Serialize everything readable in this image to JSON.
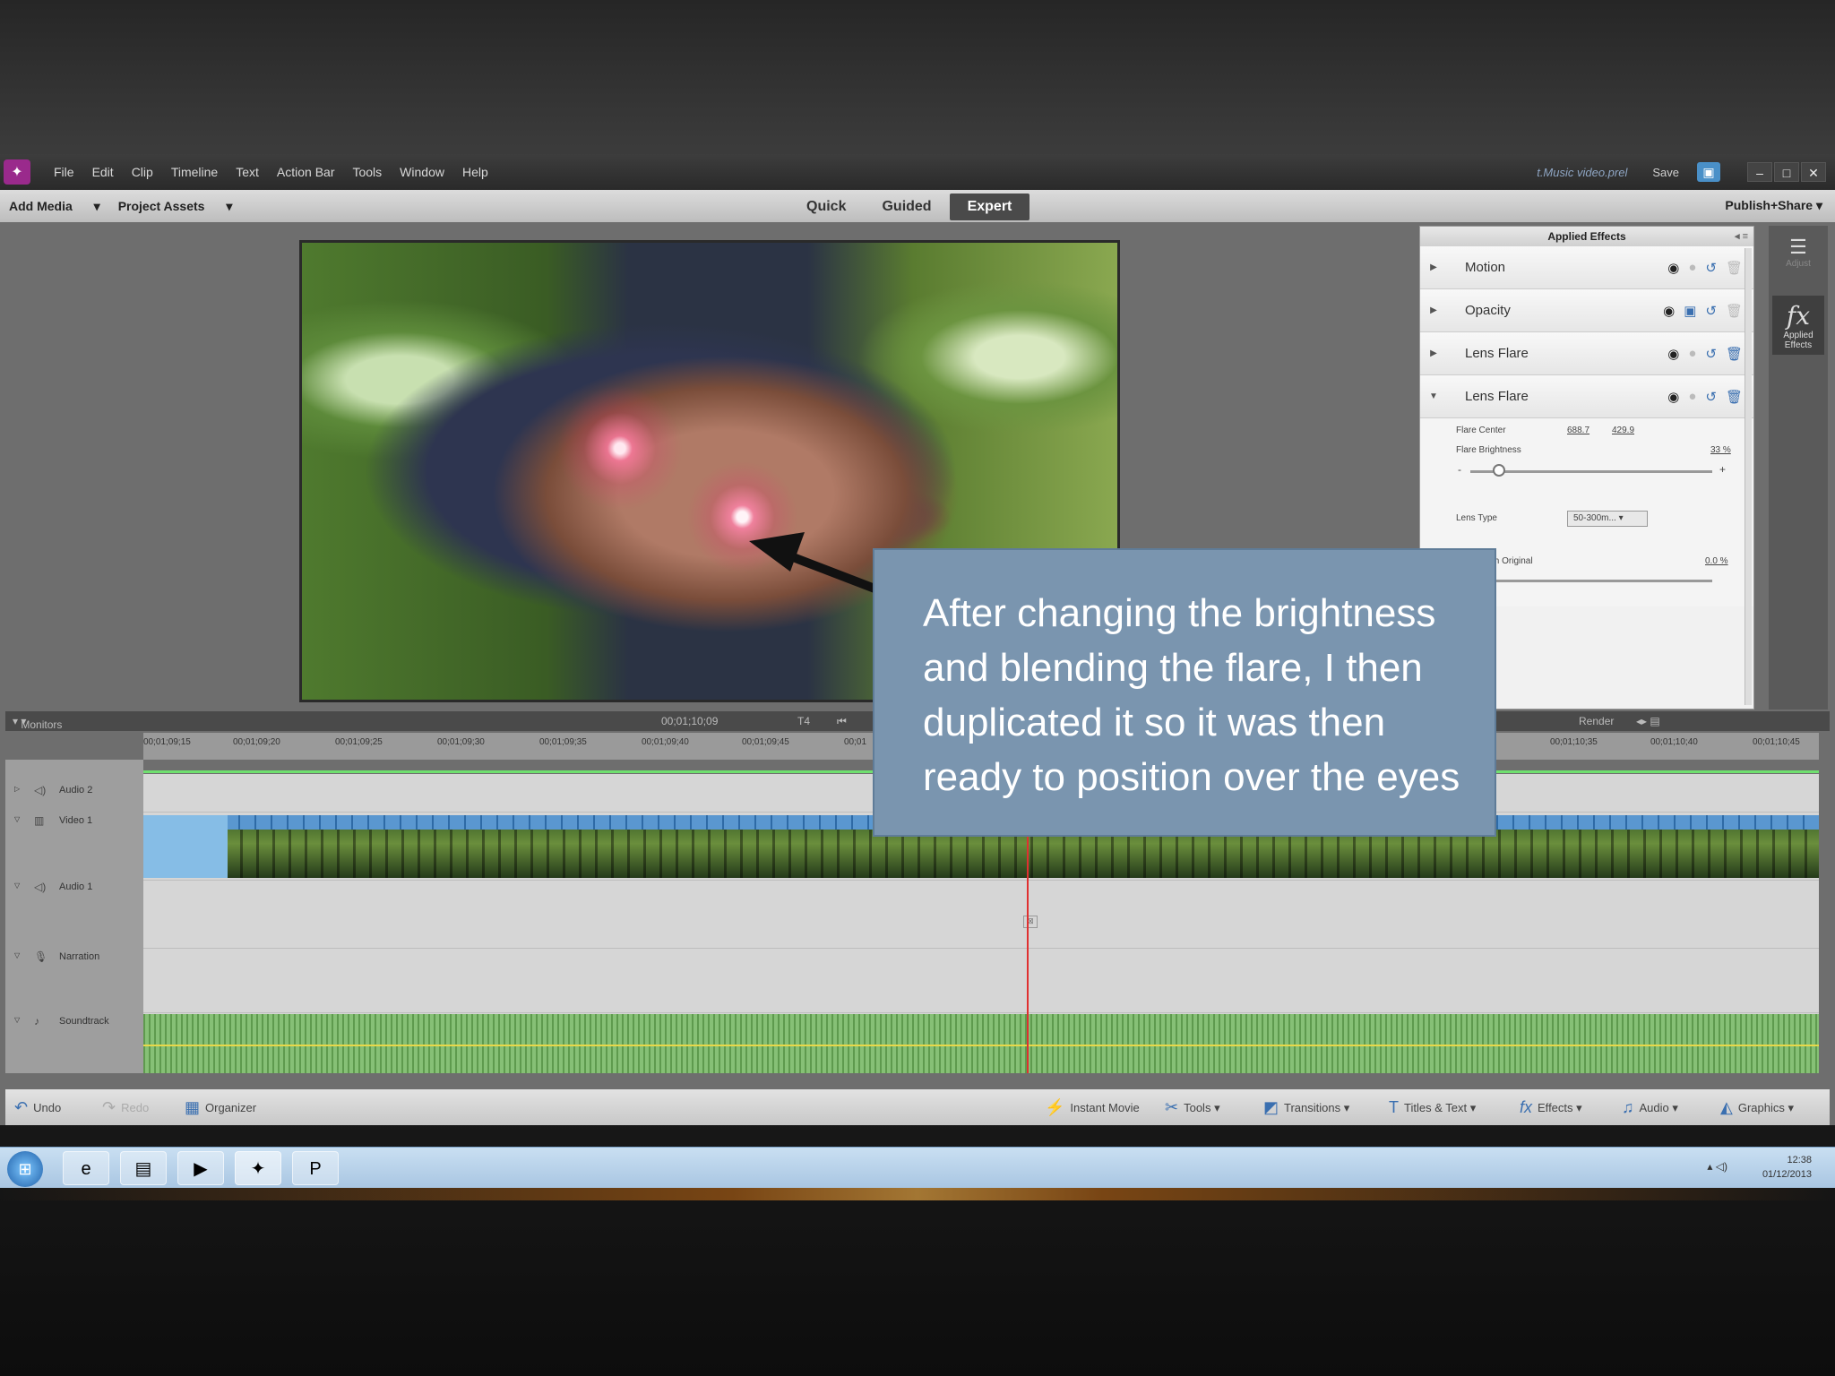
{
  "menu": {
    "items": [
      "File",
      "Edit",
      "Clip",
      "Timeline",
      "Text",
      "Action Bar",
      "Tools",
      "Window",
      "Help"
    ],
    "project_name": "t.Music video.prel",
    "save_label": "Save"
  },
  "modebar": {
    "add_media": "Add Media",
    "project_assets": "Project Assets",
    "tabs": [
      "Quick",
      "Guided",
      "Expert"
    ],
    "active_tab": "Expert",
    "publish_share": "Publish+Share"
  },
  "effects_panel": {
    "title": "Applied Effects",
    "effects": [
      "Motion",
      "Opacity",
      "Lens Flare",
      "Lens Flare"
    ],
    "expanded": {
      "flare_center_label": "Flare Center",
      "flare_center_x": "688.7",
      "flare_center_y": "429.9",
      "flare_brightness_label": "Flare Brightness",
      "flare_brightness_value": "33 %",
      "flare_brightness_fraction": 0.12,
      "lens_type_label": "Lens Type",
      "lens_type_value": "50-300m...",
      "blend_label": "Blend With Original",
      "blend_value": "0.0 %"
    }
  },
  "side_tools": {
    "adjust": "Adjust",
    "applied_effects": "Applied Effects"
  },
  "timeline": {
    "monitors_label": "Monitors",
    "timecode": "00;01;10;09",
    "render_label": "Render",
    "ruler": [
      "00;01;09;15",
      "00;01;09;20",
      "00;01;09;25",
      "00;01;09;30",
      "00;01;09;35",
      "00;01;09;40",
      "00;01;09;45",
      "00;01",
      "00;01;10;35",
      "00;01;10;40",
      "00;01;10;45"
    ],
    "tracks": [
      "Audio 2",
      "Video 1",
      "Audio 1",
      "Narration",
      "Soundtrack"
    ]
  },
  "actionbar": {
    "undo": "Undo",
    "redo": "Redo",
    "organizer": "Organizer",
    "instant_movie": "Instant Movie",
    "tools": "Tools",
    "transitions": "Transitions",
    "titles_text": "Titles & Text",
    "effects": "Effects",
    "audio": "Audio",
    "graphics": "Graphics"
  },
  "taskbar": {
    "time": "12:38",
    "date": "01/12/2013"
  },
  "callout": {
    "text": "After changing the brightness and blending the flare, I then duplicated it so it was then ready to position over the eyes"
  },
  "colors": {
    "callout_bg": "#7a95af",
    "accent": "#3a6fb0",
    "app_logo": "#9a2a8c"
  }
}
